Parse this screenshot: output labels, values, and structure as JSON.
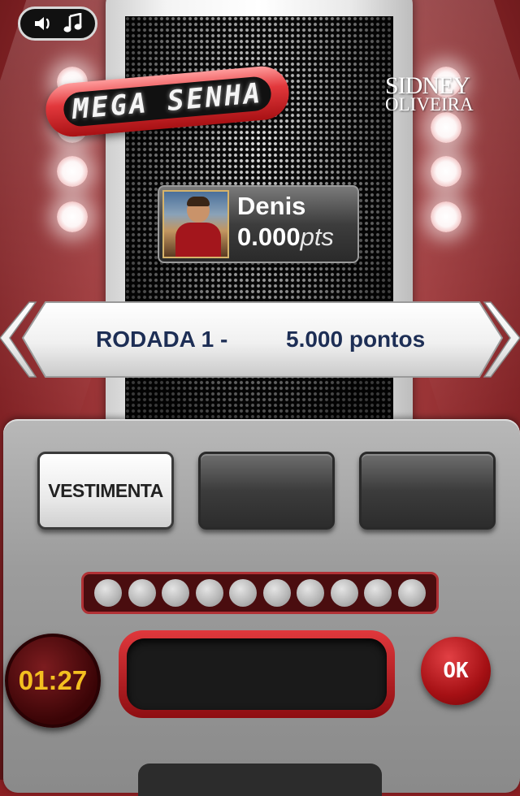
{
  "app": {
    "logo_text": "MEGA SENHA",
    "sponsor_line1": "SIDNEY",
    "sponsor_line2": "OLIVEIRA"
  },
  "sound_toggle": {
    "icons": [
      "speaker-icon",
      "music-note-icon"
    ]
  },
  "player": {
    "name": "Denis",
    "score": "0.000",
    "score_unit": "pts"
  },
  "round": {
    "label": "RODADA 1 -",
    "points": "5.000 pontos"
  },
  "clue_tiles": [
    {
      "label": "VESTIMENTA",
      "revealed": true
    },
    {
      "label": "",
      "revealed": false
    },
    {
      "label": "",
      "revealed": false
    }
  ],
  "letter_slots": {
    "count": 10
  },
  "timer": {
    "value": "01:27"
  },
  "answer_input": {
    "value": ""
  },
  "ok_button": {
    "label": "OK"
  },
  "colors": {
    "panel_red": "#a51014",
    "timer_digits": "#f4c020",
    "banner_text": "#1d2e55"
  }
}
